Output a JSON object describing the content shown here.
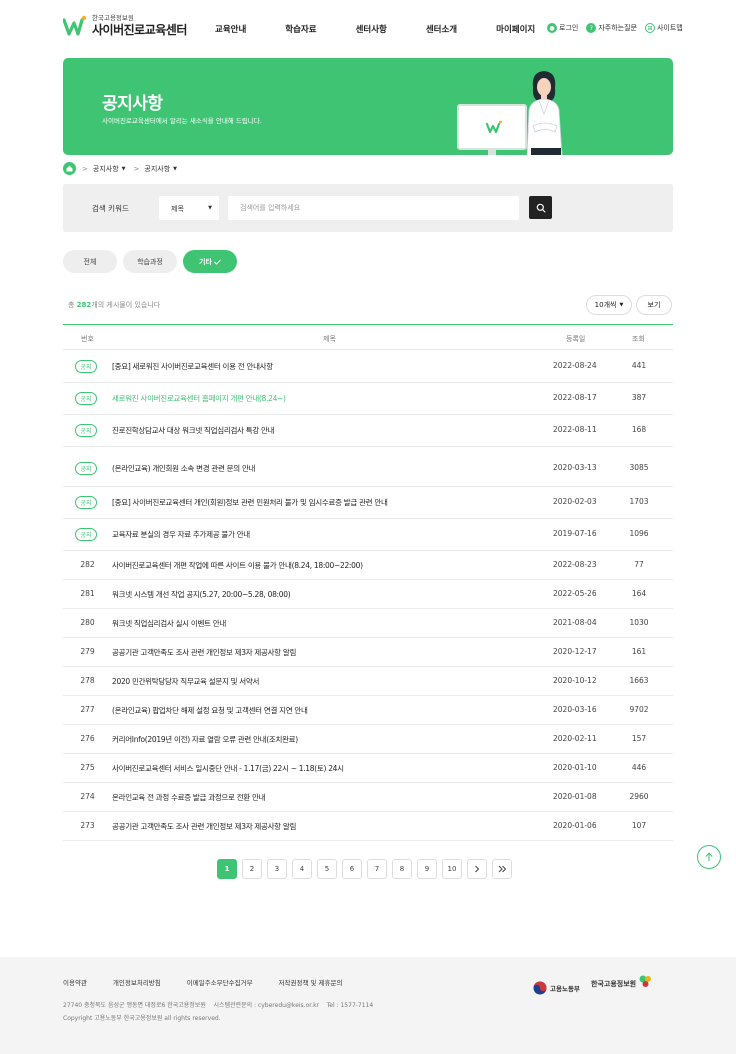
{
  "header": {
    "logo_sub": "한국고용정보원",
    "logo_main": "사이버진로교육센터",
    "nav": [
      "교육안내",
      "학습자료",
      "센터사항",
      "센터소개",
      "마이페이지"
    ],
    "util": [
      {
        "label": "로그인",
        "icon": "user-icon"
      },
      {
        "label": "자주하는질문",
        "icon": "question-icon"
      },
      {
        "label": "사이트맵",
        "icon": "sitemap-icon"
      }
    ]
  },
  "banner": {
    "title": "공지사항",
    "desc": "사이버진로교육센터에서 알리는 새소식을 안내해 드립니다."
  },
  "breadcrumb": [
    "공지사항",
    "공지사항"
  ],
  "search": {
    "label": "검색 키워드",
    "select_value": "제목",
    "placeholder": "검색어를 입력하세요"
  },
  "categories": [
    "전체",
    "학습과정",
    "기타"
  ],
  "list_info": {
    "prefix": "총 ",
    "count": "282",
    "suffix": "개의 게시물이 있습니다",
    "per_page": "10개씩",
    "view_label": "보기"
  },
  "table": {
    "headers": {
      "no": "번호",
      "title": "제목",
      "date": "등록일",
      "views": "조회"
    },
    "notices": [
      {
        "badge": "공지",
        "title": "[중요] 새로워진 사이버진로교육센터 이용 전 안내사항",
        "date": "2022-08-24",
        "views": "441",
        "highlight": false
      },
      {
        "badge": "공지",
        "title": "새로워진 사이버진로교육센터 홈페이지 개편 안내(8.24~)",
        "date": "2022-08-17",
        "views": "387",
        "highlight": true
      },
      {
        "badge": "공지",
        "title": "진로진학상담교사 대상 워크넷 직업심리검사 특강 안내",
        "date": "2022-08-11",
        "views": "168",
        "highlight": false
      },
      {
        "badge": "공지",
        "title": "(온라인교육) 개인회원 소속 변경 관련 문의 안내",
        "date": "2020-03-13",
        "views": "3085",
        "highlight": false
      },
      {
        "badge": "공지",
        "title": "[중요] 사이버진로교육센터 개인(회원)정보 관련 민원처리 불가 및 임시수료증 발급 관련 안내",
        "date": "2020-02-03",
        "views": "1703",
        "highlight": false
      },
      {
        "badge": "공지",
        "title": "교육자료 분실의 경우 자료 추가제공 불가 안내",
        "date": "2019-07-16",
        "views": "1096",
        "highlight": false
      }
    ],
    "rows": [
      {
        "no": "282",
        "title": "사이버진로교육센터 개편 작업에 따른 사이트 이용 불가 안내(8.24, 18:00~22:00)",
        "date": "2022-08-23",
        "views": "77"
      },
      {
        "no": "281",
        "title": "워크넷 시스템 개선 작업 공지(5.27, 20:00~5.28, 08:00)",
        "date": "2022-05-26",
        "views": "164"
      },
      {
        "no": "280",
        "title": "워크넷 직업심리검사 실시 이벤트 안내",
        "date": "2021-08-04",
        "views": "1030"
      },
      {
        "no": "279",
        "title": "공공기관 고객만족도 조사 관련 개인정보 제3자 제공사항 알림",
        "date": "2020-12-17",
        "views": "161"
      },
      {
        "no": "278",
        "title": "2020 민간위탁당당자 직무교육 설문지 및 서약서",
        "date": "2020-10-12",
        "views": "1663"
      },
      {
        "no": "277",
        "title": "(온라인교육) 팝업차단 해제 설정 요청 및 고객센터 연결 지연 안내",
        "date": "2020-03-16",
        "views": "9702"
      },
      {
        "no": "276",
        "title": "커리어Info(2019년 이전) 자료 열람 오류 관련 안내(조치완료)",
        "date": "2020-02-11",
        "views": "157"
      },
      {
        "no": "275",
        "title": "사이버진로교육센터 서비스 일시중단 안내 - 1.17(금) 22시 ~ 1.18(토) 24시",
        "date": "2020-01-10",
        "views": "446"
      },
      {
        "no": "274",
        "title": "온라인교육 전 과정 수료증 발급 과정으로 전환 안내",
        "date": "2020-01-08",
        "views": "2960"
      },
      {
        "no": "273",
        "title": "공공기관 고객만족도 조사 관련 개인정보 제3자 제공사항 알림",
        "date": "2020-01-06",
        "views": "107"
      }
    ]
  },
  "pagination": [
    "1",
    "2",
    "3",
    "4",
    "5",
    "6",
    "7",
    "8",
    "9",
    "10"
  ],
  "footer": {
    "links": [
      "이용약관",
      "개인정보처리방침",
      "이메일주소무단수집거부",
      "저작권정책 및 제휴문의"
    ],
    "address": "27740 충청북도 음성군 맹동면 대정로6 한국고용정보원    시스템관련문의 : cyberedu@keis.or.kr    Tel : 1577-7114",
    "copyright": "Copyright 고용노동부 한국고용정보원 all rights reserved.",
    "logo1": "고용노동부",
    "logo2": "한국고용정보원"
  },
  "colors": {
    "accent": "#3fc474",
    "dark": "#222222"
  }
}
